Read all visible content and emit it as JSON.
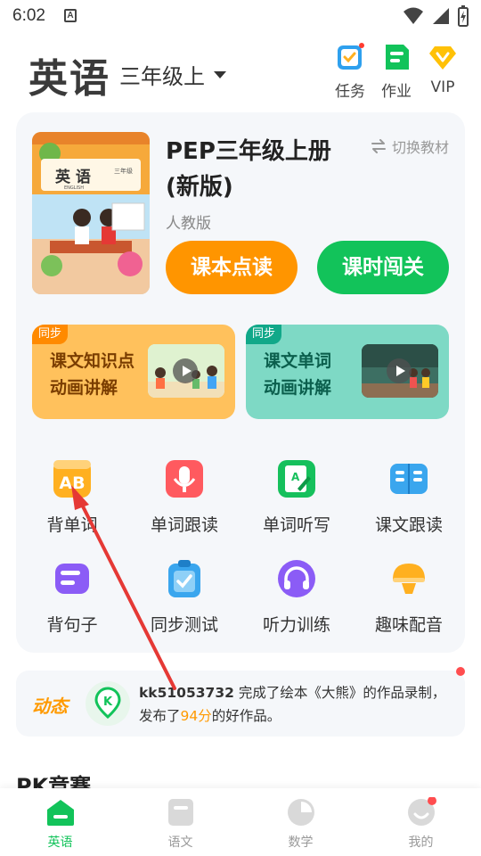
{
  "status_bar": {
    "time": "6:02",
    "notif_letter": "A"
  },
  "header": {
    "subject": "英语",
    "grade": "三年级上",
    "actions": [
      {
        "label": "任务",
        "icon": "task-icon"
      },
      {
        "label": "作业",
        "icon": "homework-icon"
      },
      {
        "label": "VIP",
        "icon": "vip-diamond-icon"
      }
    ]
  },
  "book": {
    "cover_title": "英 语",
    "cover_english": "ENGLISH",
    "cover_grade": "三年级",
    "title": "PEP三年级上册(新版)",
    "publisher": "人教版",
    "switch_label": "切换教材",
    "read_button": "课本点读",
    "pass_button": "课时闯关"
  },
  "promos": [
    {
      "tag": "同步",
      "line1": "课文知识点",
      "line2": "动画讲解"
    },
    {
      "tag": "同步",
      "line1": "课文单词",
      "line2": "动画讲解"
    }
  ],
  "features": [
    {
      "label": "背单词",
      "icon": "ab-letters-icon",
      "color": "#ffb020"
    },
    {
      "label": "单词跟读",
      "icon": "microphone-icon",
      "color": "#ff5a5f"
    },
    {
      "label": "单词听写",
      "icon": "pencil-a-icon",
      "color": "#16c05c"
    },
    {
      "label": "课文跟读",
      "icon": "open-book-icon",
      "color": "#3aa6ee"
    },
    {
      "label": "背句子",
      "icon": "sentence-card-icon",
      "color": "#8b5cf6"
    },
    {
      "label": "同步测试",
      "icon": "clipboard-check-icon",
      "color": "#3aa6ee"
    },
    {
      "label": "听力训练",
      "icon": "headphones-icon",
      "color": "#8b5cf6"
    },
    {
      "label": "趣味配音",
      "icon": "bell-dub-icon",
      "color": "#ffb020"
    }
  ],
  "activity": {
    "title": "动态",
    "user": "kk51053732",
    "text_before": " 完成了绘本《大熊》的作品录制，发布了",
    "score": "94分",
    "text_after": "的好作品。"
  },
  "section_title": "PK竞赛",
  "tabs": [
    {
      "label": "英语",
      "icon": "home-icon",
      "active": true
    },
    {
      "label": "语文",
      "icon": "chinese-book-icon",
      "active": false
    },
    {
      "label": "数学",
      "icon": "math-icon",
      "active": false
    },
    {
      "label": "我的",
      "icon": "profile-icon",
      "active": false
    }
  ],
  "colors": {
    "primary_green": "#12c35a",
    "orange": "#ff9500",
    "accent_red": "#ff4d4f"
  }
}
